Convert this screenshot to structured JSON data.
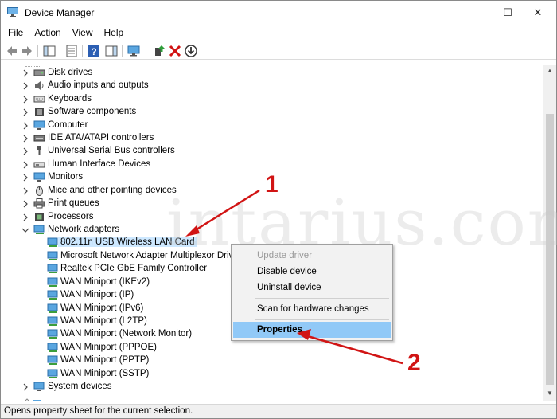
{
  "window": {
    "title": "Device Manager",
    "controls": {
      "minimize": "—",
      "maximize": "☐",
      "close": "✕"
    }
  },
  "menu": [
    "File",
    "Action",
    "View",
    "Help"
  ],
  "toolbar": {
    "buttons": [
      "back-arrow-icon",
      "forward-arrow-icon",
      "show-hide-console-tree-icon",
      "properties-page-icon",
      "help-icon",
      "action-pane-icon",
      "monitor-icon",
      "update-driver-icon",
      "uninstall-x-icon",
      "download-arrow-icon"
    ]
  },
  "tree": {
    "categories": [
      {
        "label": "Disk drives",
        "icon": "disk-drive-icon"
      },
      {
        "label": "Audio inputs and outputs",
        "icon": "speaker-icon"
      },
      {
        "label": "Keyboards",
        "icon": "keyboard-icon"
      },
      {
        "label": "Software components",
        "icon": "software-component-icon"
      },
      {
        "label": "Computer",
        "icon": "computer-icon"
      },
      {
        "label": "IDE ATA/ATAPI controllers",
        "icon": "ide-controller-icon"
      },
      {
        "label": "Universal Serial Bus controllers",
        "icon": "usb-icon"
      },
      {
        "label": "Human Interface Devices",
        "icon": "hid-icon"
      },
      {
        "label": "Monitors",
        "icon": "monitor-icon"
      },
      {
        "label": "Mice and other pointing devices",
        "icon": "mouse-icon"
      },
      {
        "label": "Print queues",
        "icon": "printer-icon"
      },
      {
        "label": "Processors",
        "icon": "processor-icon"
      },
      {
        "label": "Network adapters",
        "icon": "network-adapter-icon",
        "expanded": true
      }
    ],
    "network_children": [
      "802.11n USB Wireless LAN Card",
      "Microsoft Network Adapter Multiplexor Driver",
      "Realtek PCIe GbE Family Controller",
      "WAN Miniport (IKEv2)",
      "WAN Miniport (IP)",
      "WAN Miniport (IPv6)",
      "WAN Miniport (L2TP)",
      "WAN Miniport (Network Monitor)",
      "WAN Miniport (PPPOE)",
      "WAN Miniport (PPTP)",
      "WAN Miniport (SSTP)"
    ],
    "after": [
      {
        "label": "System devices",
        "icon": "system-devices-icon"
      }
    ],
    "selected_child": 0
  },
  "context_menu": {
    "items": [
      {
        "label": "Update driver",
        "disabled": true
      },
      {
        "label": "Disable device"
      },
      {
        "label": "Uninstall device"
      },
      {
        "label": "Scan for hardware changes"
      },
      {
        "label": "Properties",
        "active": true
      }
    ]
  },
  "annotations": {
    "one": "1",
    "two": "2",
    "color": "#d11414"
  },
  "watermark": "intarius.com",
  "status": {
    "text": "Opens property sheet for the current selection."
  },
  "colors": {
    "selection": "#cde8ff",
    "menu_highlight": "#91c9f7",
    "annotation": "#d11414"
  }
}
